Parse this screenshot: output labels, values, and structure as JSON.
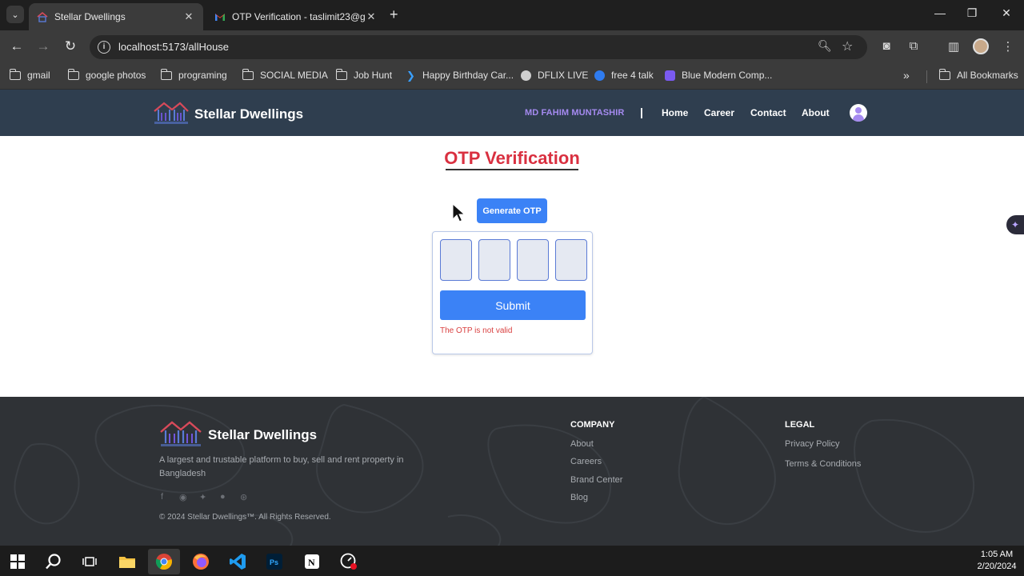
{
  "browser": {
    "tabs": [
      {
        "title": "Stellar Dwellings",
        "active": true
      },
      {
        "title": "OTP Verification - taslimit23@g",
        "active": false
      }
    ],
    "url": "localhost:5173/allHouse",
    "bookmarks": [
      {
        "label": "gmail",
        "icon": "folder-icon"
      },
      {
        "label": "google photos",
        "icon": "folder-icon"
      },
      {
        "label": "programing",
        "icon": "folder-icon"
      },
      {
        "label": "SOCIAL MEDIA",
        "icon": "folder-icon"
      },
      {
        "label": "Job Hunt",
        "icon": "folder-icon"
      },
      {
        "label": "Happy Birthday Car...",
        "icon": "arrow-site-icon"
      },
      {
        "label": "DFLIX LIVE",
        "icon": "globe-icon"
      },
      {
        "label": "free 4 talk",
        "icon": "circle-site-icon"
      },
      {
        "label": "Blue Modern Comp...",
        "icon": "heart-site-icon"
      }
    ],
    "all_bookmarks": "All Bookmarks"
  },
  "site": {
    "brand": "Stellar Dwellings",
    "nav": {
      "user": "MD FAHIM MUNTASHIR",
      "separator": "|",
      "links": [
        "Home",
        "Career",
        "Contact",
        "About"
      ]
    }
  },
  "otp": {
    "title": "OTP Verification",
    "generate_label": "Generate OTP",
    "submit_label": "Submit",
    "error": "The OTP is not valid",
    "digits": [
      "",
      "",
      "",
      ""
    ]
  },
  "footer": {
    "brand": "Stellar Dwellings",
    "description": "A largest and trustable platform to buy, sell and rent property in Bangladesh",
    "social": [
      "facebook-icon",
      "discord-icon",
      "twitter-icon",
      "github-icon",
      "dribbble-icon"
    ],
    "copyright": "© 2024 Stellar Dwellings™. All Rights Reserved.",
    "company": {
      "heading": "COMPANY",
      "links": [
        "About",
        "Careers",
        "Brand Center",
        "Blog"
      ]
    },
    "legal": {
      "heading": "LEGAL",
      "links": [
        "Privacy Policy",
        "Terms & Conditions"
      ]
    }
  },
  "taskbar": {
    "time": "1:05 AM",
    "date": "2/20/2024"
  },
  "colors": {
    "header_bg": "#2f3e4f",
    "accent_blue": "#3b82f6",
    "title_red": "#d93040",
    "user_purple": "#a58af0",
    "footer_bg": "#2f3236"
  }
}
